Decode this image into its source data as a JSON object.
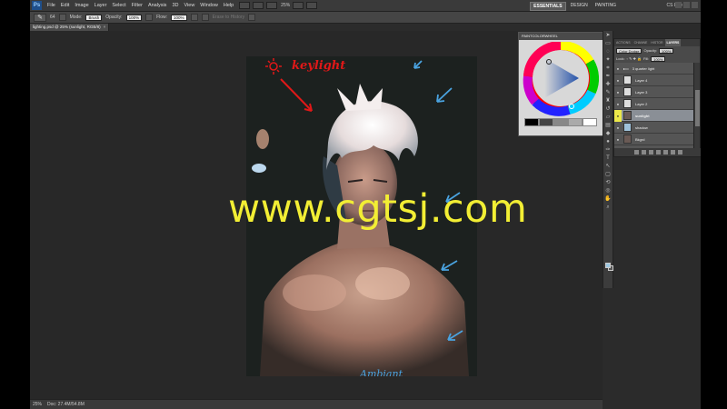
{
  "menubar": {
    "logo": "Ps",
    "items": [
      "File",
      "Edit",
      "Image",
      "Layer",
      "Select",
      "Filter",
      "Analysis",
      "3D",
      "View",
      "Window",
      "Help"
    ],
    "zoom": "25%",
    "workspaces": [
      "ESSENTIALS",
      "DESIGN",
      "PAINTING"
    ],
    "cs_live": "CS Live"
  },
  "options": {
    "brush_size": "64",
    "mode_label": "Mode:",
    "mode_value": "Brush",
    "opacity_label": "Opacity:",
    "opacity_value": "100%",
    "flow_label": "Flow:",
    "flow_value": "100%",
    "erase_to_history": "Erase to History"
  },
  "document": {
    "tab_title": "lighting.psd @ 25% (sunlight, RGB/8)"
  },
  "status": {
    "zoom": "25%",
    "doc": "Doc: 27.4M/54.8M"
  },
  "artwork": {
    "keylight_label": "keylight",
    "ambient_label": "Ambiant"
  },
  "watermark": "www.cgtsj.com",
  "color_panel": {
    "title": "PAINTCOLORWHEEL",
    "swatch_colors": [
      "#000000",
      "#444444",
      "#888888",
      "#aaaaaa",
      "#dddddd",
      "#ffffff"
    ]
  },
  "layers_panel": {
    "tabs": [
      "ACTIONS",
      "CHANNE",
      "HISTOR",
      "LAYERS"
    ],
    "blend_mode": "Color Dodge",
    "opacity_label": "Opacity:",
    "opacity_value": "100%",
    "lock_label": "Lock:",
    "fill_label": "Fill:",
    "fill_value": "100%",
    "layers": [
      {
        "name": "3 quarter light",
        "active": false
      },
      {
        "name": "Layer 4",
        "active": false
      },
      {
        "name": "Layer 3",
        "active": false
      },
      {
        "name": "Layer 2",
        "active": false
      },
      {
        "name": "sunlight",
        "active": true
      },
      {
        "name": "shadow",
        "active": false
      },
      {
        "name": "Bkgrd",
        "active": false
      }
    ]
  },
  "colors": {
    "watermark": "#f2ee34",
    "keylight_red": "#e01818",
    "ambient_blue": "#4aa3e0",
    "fg_color": "#9cc6e0"
  }
}
